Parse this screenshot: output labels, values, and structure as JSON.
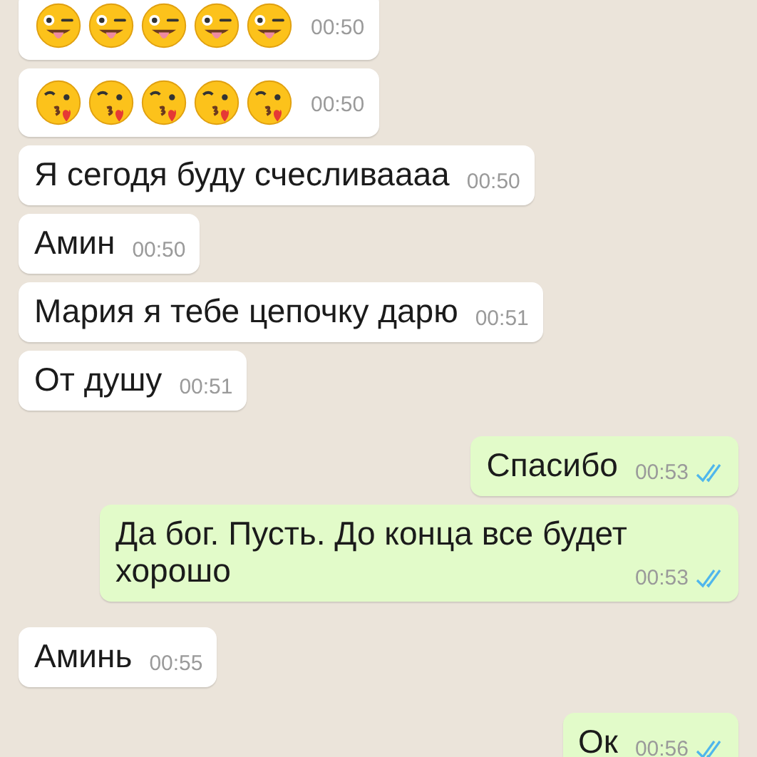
{
  "messages": [
    {
      "outgoing": false,
      "kind": "emoji",
      "emojis": [
        {
          "kind": "wink_tongue"
        },
        {
          "kind": "wink_tongue"
        },
        {
          "kind": "wink_tongue"
        },
        {
          "kind": "wink_tongue"
        },
        {
          "kind": "wink_tongue"
        }
      ],
      "time": "00:50"
    },
    {
      "outgoing": false,
      "kind": "emoji",
      "emojis": [
        {
          "kind": "kiss_heart"
        },
        {
          "kind": "kiss_heart"
        },
        {
          "kind": "kiss_heart"
        },
        {
          "kind": "kiss_heart"
        },
        {
          "kind": "kiss_heart"
        }
      ],
      "time": "00:50"
    },
    {
      "outgoing": false,
      "kind": "text",
      "text": "Я сегодя буду счесливаааа",
      "time": "00:50"
    },
    {
      "outgoing": false,
      "kind": "text",
      "text": "Амин",
      "time": "00:50"
    },
    {
      "outgoing": false,
      "kind": "text",
      "text": "Мария я тебе цепочку дарю",
      "time": "00:51"
    },
    {
      "outgoing": false,
      "kind": "text",
      "text": "От душу",
      "time": "00:51"
    },
    {
      "outgoing": true,
      "kind": "text",
      "text": "Спасибо",
      "time": "00:53",
      "read": true
    },
    {
      "outgoing": true,
      "kind": "text",
      "text": "Да бог. Пусть. До конца все будет хорошо",
      "time": "00:53",
      "read": true
    },
    {
      "outgoing": false,
      "kind": "text",
      "text": "Аминь",
      "time": "00:55"
    },
    {
      "outgoing": true,
      "kind": "text",
      "text": "Ок",
      "time": "00:56",
      "read": true
    }
  ]
}
